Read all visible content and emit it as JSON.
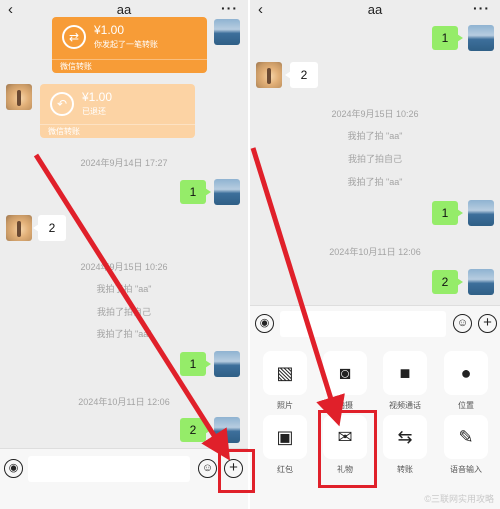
{
  "left": {
    "title": "aa",
    "back_glyph": "‹",
    "more_glyph": "···",
    "transfer_sent": {
      "amount": "¥1.00",
      "desc": "你发起了一笔转账",
      "footer": "微信转账"
    },
    "transfer_returned": {
      "amount": "¥1.00",
      "desc": "已退还",
      "footer": "微信转账"
    },
    "timestamp_1": "2024年9月14日 17:27",
    "msg_1": "1",
    "msg_2": "2",
    "timestamp_2": "2024年9月15日 10:26",
    "system_1": "我拍了拍 \"aa\"",
    "system_2": "我拍了拍自己",
    "system_3": "我拍了拍 \"aa\"",
    "msg_3": "1",
    "timestamp_3": "2024年10月11日 12:06",
    "msg_4": "2",
    "voice_glyph": "◉",
    "emoji_glyph": "☺",
    "plus_glyph": "+"
  },
  "right": {
    "title": "aa",
    "back_glyph": "‹",
    "more_glyph": "···",
    "msg_1": "1",
    "msg_2": "2",
    "timestamp_1": "2024年9月15日 10:26",
    "system_1": "我拍了拍 \"aa\"",
    "system_2": "我拍了拍自己",
    "system_3": "我拍了拍 \"aa\"",
    "msg_3": "1",
    "timestamp_2": "2024年10月11日 12:06",
    "msg_4": "2",
    "voice_glyph": "◉",
    "emoji_glyph": "☺",
    "plus_glyph": "+",
    "tools": [
      {
        "label": "照片",
        "icon": "photo-icon",
        "glyph": "▧"
      },
      {
        "label": "拍摄",
        "icon": "camera-icon",
        "glyph": "◙"
      },
      {
        "label": "视频通话",
        "icon": "video-call-icon",
        "glyph": "■"
      },
      {
        "label": "位置",
        "icon": "location-icon",
        "glyph": "●"
      },
      {
        "label": "红包",
        "icon": "red-packet-icon",
        "glyph": "▣"
      },
      {
        "label": "礼物",
        "icon": "gift-icon",
        "glyph": "✉"
      },
      {
        "label": "转账",
        "icon": "transfer-icon",
        "glyph": "⇆"
      },
      {
        "label": "语音输入",
        "icon": "microphone-icon",
        "glyph": "✎"
      }
    ]
  },
  "watermark": "©三联网实用攻略",
  "colors": {
    "bubble": "#95ec69",
    "transfer": "#f79c37",
    "transfer_returned": "#fcd3a4",
    "annotation": "#e0202a"
  }
}
